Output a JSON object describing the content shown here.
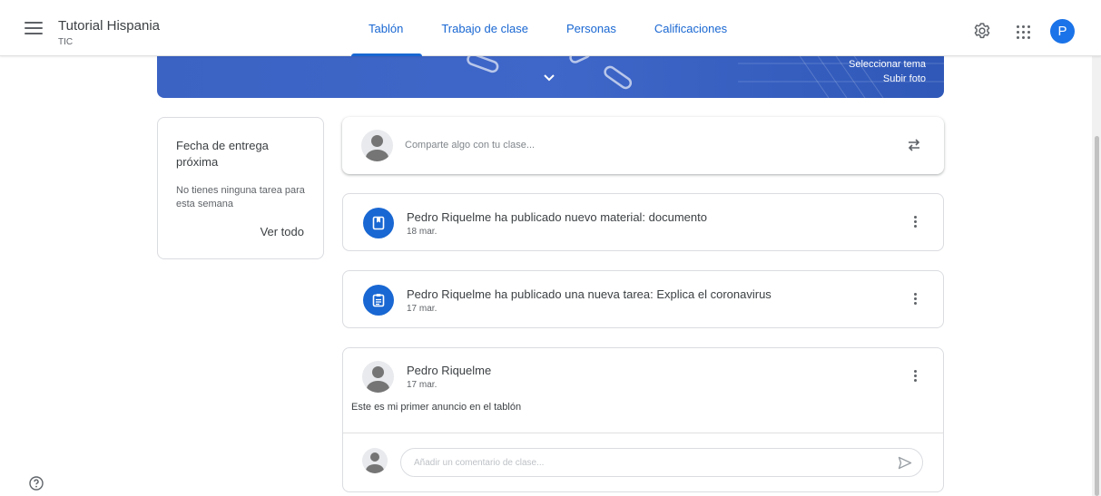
{
  "header": {
    "class_name": "Tutorial Hispania",
    "class_section": "TIC",
    "tabs": [
      {
        "label": "Tablón",
        "active": true
      },
      {
        "label": "Trabajo de clase",
        "active": false
      },
      {
        "label": "Personas",
        "active": false
      },
      {
        "label": "Calificaciones",
        "active": false
      }
    ],
    "avatar_letter": "P",
    "icons": [
      "menu-icon",
      "settings-icon",
      "apps-icon"
    ]
  },
  "banner": {
    "select_theme": "Seleccionar tema",
    "upload_photo": "Subir foto"
  },
  "upcoming": {
    "title": "Fecha de entrega próxima",
    "message": "No tienes ninguna tarea para esta semana",
    "view_all": "Ver todo"
  },
  "share": {
    "placeholder": "Comparte algo con tu clase..."
  },
  "posts": [
    {
      "type": "material",
      "title": "Pedro Riquelme ha publicado nuevo material: documento",
      "date": "18 mar."
    },
    {
      "type": "assignment",
      "title": "Pedro Riquelme ha publicado una nueva tarea: Explica el coronavirus",
      "date": "17 mar."
    }
  ],
  "announcement": {
    "author": "Pedro Riquelme",
    "date": "17 mar.",
    "text": "Este es mi primer anuncio en el tablón",
    "comment_placeholder": "Añadir un comentario de clase..."
  },
  "colors": {
    "accent": "#1967d2",
    "banner": "#3f67c9",
    "avatar": "#1a73e8"
  }
}
